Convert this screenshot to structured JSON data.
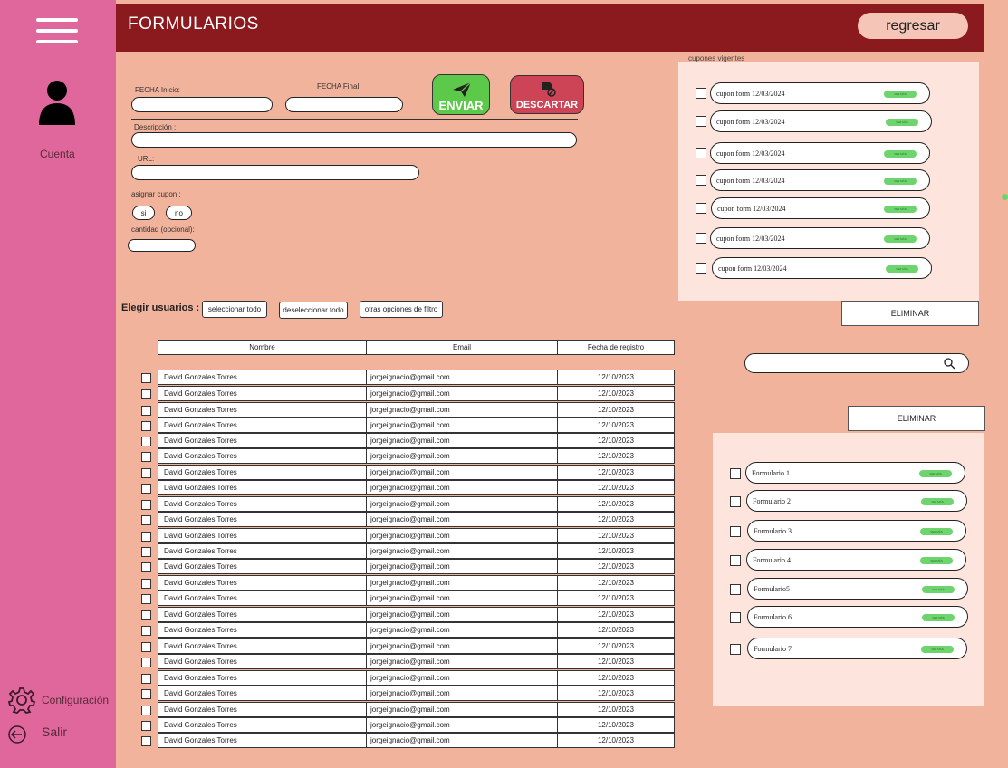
{
  "header": {
    "title": "FORMULARIOS",
    "back_label": "regresar"
  },
  "sidebar": {
    "account_label": "Cuenta",
    "settings_label": "Configuración",
    "logout_label": "Salir"
  },
  "form": {
    "fecha_inicio_label": "FECHA Inicio:",
    "fecha_final_label": "FECHA Final:",
    "descripcion_label": "Descripción :",
    "url_label": "URL:",
    "asignar_cupon_label": "asignar cupon :",
    "si_label": "si",
    "no_label": "no",
    "cantidad_label": "cantidad (opcional):",
    "enviar_label": "ENVIAR",
    "descartar_label": "DESCARTAR"
  },
  "users": {
    "title": "Elegir usuarios :",
    "select_all": "seleccionar todo",
    "deselect_all": "deseleccionar todo",
    "filter_options": "otras opciones de filtro",
    "columns": [
      "Nombre",
      "Email",
      "Fecha de registro"
    ],
    "rows": [
      [
        "David Gonzales Torres",
        "jorgeignacio@gmail.com",
        "12/10/2023"
      ],
      [
        "David Gonzales Torres",
        "jorgeignacio@gmail.com",
        "12/10/2023"
      ],
      [
        "David Gonzales Torres",
        "jorgeignacio@gmail.com",
        "12/10/2023"
      ],
      [
        "David Gonzales Torres",
        "jorgeignacio@gmail.com",
        "12/10/2023"
      ],
      [
        "David Gonzales Torres",
        "jorgeignacio@gmail.com",
        "12/10/2023"
      ],
      [
        "David Gonzales Torres",
        "jorgeignacio@gmail.com",
        "12/10/2023"
      ],
      [
        "David Gonzales Torres",
        "jorgeignacio@gmail.com",
        "12/10/2023"
      ],
      [
        "David Gonzales Torres",
        "jorgeignacio@gmail.com",
        "12/10/2023"
      ],
      [
        "David Gonzales Torres",
        "jorgeignacio@gmail.com",
        "12/10/2023"
      ],
      [
        "David Gonzales Torres",
        "jorgeignacio@gmail.com",
        "12/10/2023"
      ],
      [
        "David Gonzales Torres",
        "jorgeignacio@gmail.com",
        "12/10/2023"
      ],
      [
        "David Gonzales Torres",
        "jorgeignacio@gmail.com",
        "12/10/2023"
      ],
      [
        "David Gonzales Torres",
        "jorgeignacio@gmail.com",
        "12/10/2023"
      ],
      [
        "David Gonzales Torres",
        "jorgeignacio@gmail.com",
        "12/10/2023"
      ],
      [
        "David Gonzales Torres",
        "jorgeignacio@gmail.com",
        "12/10/2023"
      ],
      [
        "David Gonzales Torres",
        "jorgeignacio@gmail.com",
        "12/10/2023"
      ],
      [
        "David Gonzales Torres",
        "jorgeignacio@gmail.com",
        "12/10/2023"
      ],
      [
        "David Gonzales Torres",
        "jorgeignacio@gmail.com",
        "12/10/2023"
      ],
      [
        "David Gonzales Torres",
        "jorgeignacio@gmail.com",
        "12/10/2023"
      ],
      [
        "David Gonzales Torres",
        "jorgeignacio@gmail.com",
        "12/10/2023"
      ],
      [
        "David Gonzales Torres",
        "jorgeignacio@gmail.com",
        "12/10/2023"
      ],
      [
        "David Gonzales Torres",
        "jorgeignacio@gmail.com",
        "12/10/2023"
      ],
      [
        "David Gonzales Torres",
        "jorgeignacio@gmail.com",
        "12/10/2023"
      ],
      [
        "David Gonzales Torres",
        "jorgeignacio@gmail.com",
        "12/10/2023"
      ]
    ]
  },
  "coupons": {
    "title": "cupones vigentes",
    "items": [
      "cupon form 12/03/2024",
      "cupon form 12/03/2024",
      "cupon form 12/03/2024",
      "cupon form 12/03/2024",
      "cupon form 12/03/2024",
      "cupon form 12/03/2024",
      "cupon form 12/03/2024"
    ],
    "ver_mas": "VER MÁS",
    "delete_label": "ELIMINAR"
  },
  "forms_panel": {
    "search_placeholder": "",
    "delete_label": "ELIMINAR",
    "items": [
      "Formulario 1",
      "Formulario 2",
      "Formulario 3",
      "Formulario 4",
      "Formulario5",
      "Formulario 6",
      "Formulario 7"
    ],
    "ver_mas": "VER MÁS"
  },
  "colors": {
    "header": "#8b1a1e",
    "sidebar": "#e0679b",
    "background": "#f2b39d",
    "panel": "#fde4dc",
    "enviar": "#5cc94a",
    "descartar": "#cc4455"
  }
}
